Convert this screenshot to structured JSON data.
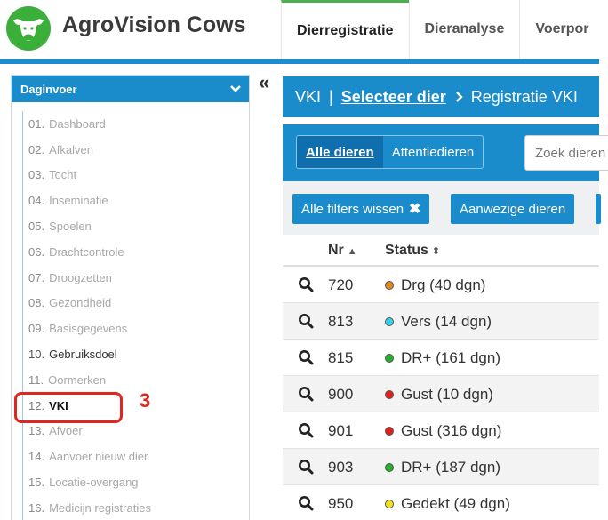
{
  "app": {
    "title": "AgroVision Cows"
  },
  "top_tabs": [
    {
      "label": "Dierregistratie",
      "active": true
    },
    {
      "label": "Dieranalyse",
      "active": false
    },
    {
      "label": "Voerpor",
      "active": false
    }
  ],
  "sidebar": {
    "title": "Daginvoer",
    "items": [
      {
        "num": "01.",
        "label": "Dashboard"
      },
      {
        "num": "02.",
        "label": "Afkalven"
      },
      {
        "num": "03.",
        "label": "Tocht"
      },
      {
        "num": "04.",
        "label": "Inseminatie"
      },
      {
        "num": "05.",
        "label": "Spoelen"
      },
      {
        "num": "06.",
        "label": "Drachtcontrole"
      },
      {
        "num": "07.",
        "label": "Droogzetten"
      },
      {
        "num": "08.",
        "label": "Gezondheid"
      },
      {
        "num": "09.",
        "label": "Basisgegevens"
      },
      {
        "num": "10.",
        "label": "Gebruiksdoel"
      },
      {
        "num": "11.",
        "label": "Oormerken"
      },
      {
        "num": "12.",
        "label": "VKI"
      },
      {
        "num": "13.",
        "label": "Afvoer"
      },
      {
        "num": "14.",
        "label": "Aanvoer nieuw dier"
      },
      {
        "num": "15.",
        "label": "Locatie-overgang"
      },
      {
        "num": "16.",
        "label": "Medicijn registraties"
      }
    ]
  },
  "annotation": {
    "step": "3"
  },
  "breadcrumb": {
    "section": "VKI",
    "separator": "|",
    "link": "Selecteer dier",
    "current": "Registratie VKI"
  },
  "filters": {
    "all_animals": "Alle dieren",
    "attention_animals": "Attentiedieren",
    "search_placeholder": "Zoek dieren",
    "clear_filters": "Alle filters wissen",
    "present_animals": "Aanwezige dieren"
  },
  "table": {
    "columns": {
      "nr": "Nr",
      "status": "Status"
    },
    "rows": [
      {
        "nr": "720",
        "status": "Drg (40 dgn)",
        "color": "#e08a1e"
      },
      {
        "nr": "813",
        "status": "Vers (14 dgn)",
        "color": "#38d1e6"
      },
      {
        "nr": "815",
        "status": "DR+ (161 dgn)",
        "color": "#21b22a"
      },
      {
        "nr": "900",
        "status": "Gust (10 dgn)",
        "color": "#e0211b"
      },
      {
        "nr": "901",
        "status": "Gust (316 dgn)",
        "color": "#e0211b"
      },
      {
        "nr": "903",
        "status": "DR+ (187 dgn)",
        "color": "#21b22a"
      },
      {
        "nr": "950",
        "status": "Gedekt (49 dgn)",
        "color": "#f2e21c"
      }
    ]
  },
  "colors": {
    "accent": "#1a8ccc",
    "brand_green": "#4cae4c",
    "highlight": "#e0271f"
  }
}
